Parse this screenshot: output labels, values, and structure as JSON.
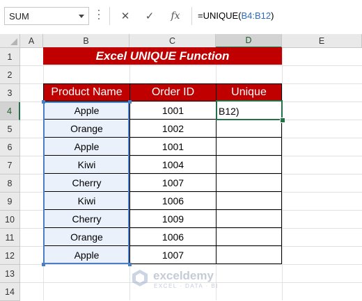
{
  "namebox": {
    "value": "SUM"
  },
  "formula_bar": {
    "prefix": "=UNIQUE(",
    "reference": "B4:B12",
    "suffix": ")"
  },
  "columns": [
    "A",
    "B",
    "C",
    "D",
    "E"
  ],
  "rows": [
    "1",
    "2",
    "3",
    "4",
    "5",
    "6",
    "7",
    "8",
    "9",
    "10",
    "11",
    "12",
    "13",
    "14"
  ],
  "title": "Excel UNIQUE Function",
  "table": {
    "headers": [
      "Product Name",
      "Order ID",
      "Unique"
    ],
    "rows": [
      [
        "Apple",
        "1001",
        ""
      ],
      [
        "Orange",
        "1002",
        ""
      ],
      [
        "Apple",
        "1001",
        ""
      ],
      [
        "Kiwi",
        "1004",
        ""
      ],
      [
        "Cherry",
        "1007",
        ""
      ],
      [
        "Kiwi",
        "1006",
        ""
      ],
      [
        "Cherry",
        "1009",
        ""
      ],
      [
        "Orange",
        "1006",
        ""
      ],
      [
        "Apple",
        "1007",
        ""
      ]
    ]
  },
  "active_cell": {
    "line1": "=UNIQUE(",
    "line2": "B12)"
  },
  "watermark": {
    "name": "exceldemy",
    "tagline": "EXCEL · DATA · BI"
  },
  "colors": {
    "title_bg": "#c00000",
    "selection": "#4a7ec6",
    "active": "#217346"
  }
}
